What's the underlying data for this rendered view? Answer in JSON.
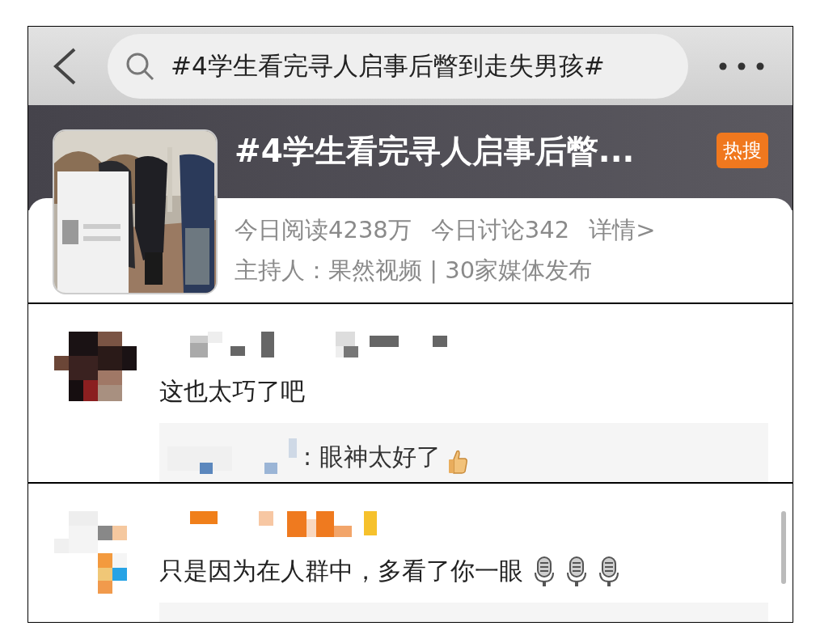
{
  "search": {
    "value": "#4学生看完寻人启事后瞥到走失男孩#"
  },
  "topic": {
    "title": "#4学生看完寻人启事后瞥...",
    "badge": "热搜",
    "stats": [
      "今日阅读4238万",
      "今日讨论342"
    ],
    "details_link": "详情>",
    "host_line": "主持人：果然视频 | 30家媒体发布",
    "thumbnail": {
      "kind": "picture"
    }
  },
  "comments": [
    {
      "text": "这也太巧了吧",
      "reply": {
        "text": ": 眼神太好了",
        "emojis": [
          {
            "kind": "thumb"
          }
        ]
      }
    },
    {
      "text": "只是因为在人群中，多看了你一眼",
      "emojis": [
        {
          "kind": "microphone"
        },
        {
          "kind": "microphone"
        },
        {
          "kind": "microphone"
        }
      ]
    }
  ]
}
